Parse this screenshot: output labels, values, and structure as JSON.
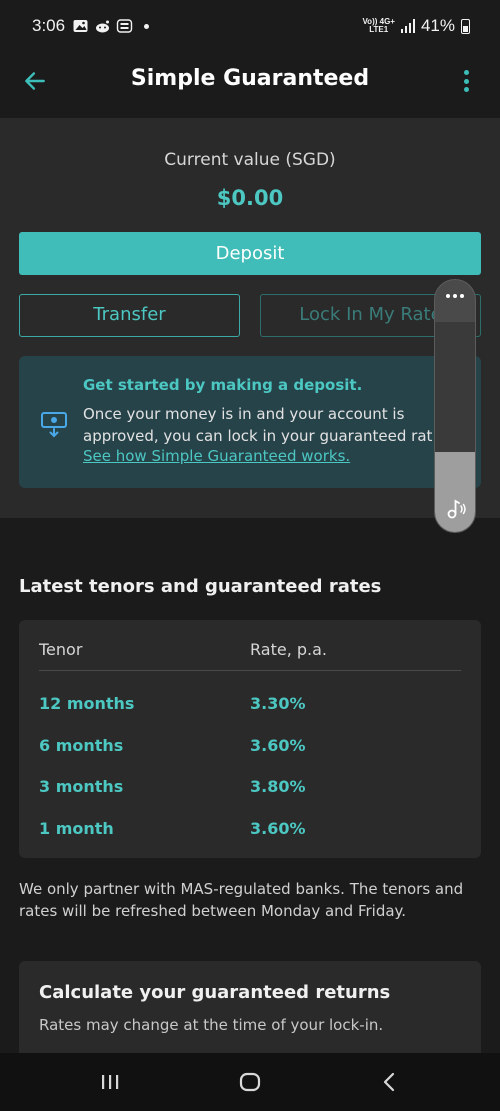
{
  "status_bar": {
    "time": "3:06",
    "network_top": "Vo)) 4G+",
    "network_bottom": "LTE1",
    "battery": "41%"
  },
  "app_bar": {
    "title": "Simple Guaranteed",
    "back_icon": "arrow-left-icon",
    "menu_icon": "kebab-menu-icon"
  },
  "account": {
    "current_value_label": "Current value (SGD)",
    "current_value": "$0.00"
  },
  "actions": {
    "deposit_label": "Deposit",
    "transfer_label": "Transfer",
    "lock_label": "Lock In My Rate"
  },
  "info_card": {
    "title": "Get started by making a deposit.",
    "body_line1": "Once your money is in and your account is",
    "body_line2": "approved, you can lock in your guaranteed rat",
    "link": "See how Simple Guaranteed works."
  },
  "volume_overlay": {
    "level": 0.38,
    "icon": "music-note-icon"
  },
  "rates": {
    "heading": "Latest tenors and guaranteed rates",
    "col_tenor": "Tenor",
    "col_rate": "Rate, p.a.",
    "rows": [
      {
        "tenor": "12 months",
        "rate": "3.30%"
      },
      {
        "tenor": "6 months",
        "rate": "3.60%"
      },
      {
        "tenor": "3 months",
        "rate": "3.80%"
      },
      {
        "tenor": "1 month",
        "rate": "3.60%"
      }
    ]
  },
  "disclaimer": "We only partner with MAS-regulated banks. The tenors and rates will be refreshed between Monday and Friday.",
  "calculator": {
    "title": "Calculate your guaranteed returns",
    "subtitle": "Rates may change at the time of your lock-in."
  },
  "nav": {
    "recents_icon": "recents-icon",
    "home_icon": "home-icon",
    "back_icon": "back-chevron-icon"
  },
  "colors": {
    "accent": "#40bdb8",
    "background": "#1b1b1b",
    "card": "#2a2a2a",
    "info_card": "#26434a"
  }
}
